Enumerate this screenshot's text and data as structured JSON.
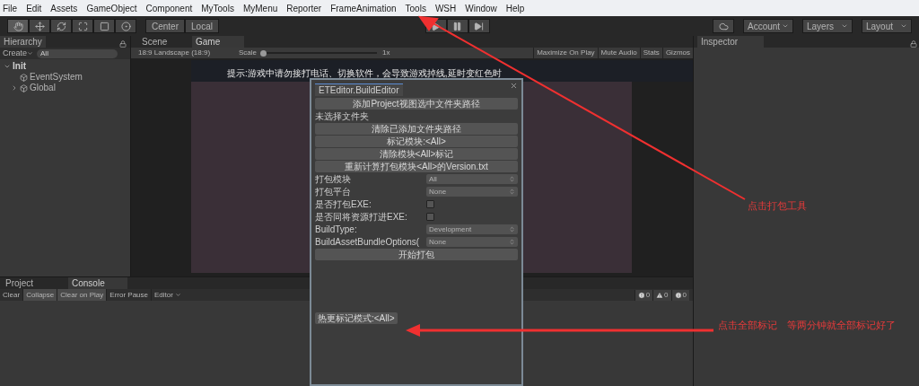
{
  "menu": [
    "File",
    "Edit",
    "Assets",
    "GameObject",
    "Component",
    "MyTools",
    "MyMenu",
    "Reporter",
    "FrameAnimation",
    "Tools",
    "WSH",
    "Window",
    "Help"
  ],
  "toolbar": {
    "tools": [
      {
        "kind": "hand",
        "selected": true
      },
      {
        "kind": "move",
        "selected": false
      },
      {
        "kind": "rotate",
        "selected": false
      },
      {
        "kind": "scale",
        "selected": false
      },
      {
        "kind": "rect",
        "selected": false
      },
      {
        "kind": "transform",
        "selected": false
      }
    ],
    "pivot": [
      "Center",
      "Local"
    ],
    "account": "Account",
    "layers": "Layers",
    "layout": "Layout"
  },
  "hierarchy": {
    "tab": "Hierarchy",
    "create": "Create",
    "search_placeholder": "All",
    "scene": "Init",
    "items": [
      {
        "label": "EventSystem",
        "kind": "leaf"
      },
      {
        "label": "Global",
        "kind": "folded"
      }
    ]
  },
  "view_tabs": [
    {
      "label": "Scene",
      "selected": false
    },
    {
      "label": "Game",
      "selected": true
    }
  ],
  "game": {
    "aspect": "18:9 Landscape (18:9)",
    "scale_label": "Scale",
    "scale": {
      "level": 0.0
    },
    "scale_reading": "1x",
    "toggles": [
      {
        "label": "Maximize On Play",
        "on": false
      },
      {
        "label": "Mute Audio",
        "on": false
      },
      {
        "label": "Stats",
        "on": false
      },
      {
        "label": "Gizmos",
        "on": false
      }
    ],
    "hint": "提示:游戏中请勿接打电话、切换软件，会导致游戏掉线,延时变红色时"
  },
  "inspector": {
    "tab": "Inspector"
  },
  "bottom_tabs": [
    {
      "label": "Project",
      "selected": false
    },
    {
      "label": "Console",
      "selected": true
    }
  ],
  "console": {
    "buttons": [
      {
        "label": "Clear",
        "on": false
      },
      {
        "label": "Collapse",
        "on": true
      },
      {
        "label": "Clear on Play",
        "on": true
      },
      {
        "label": "Error Pause",
        "on": false
      }
    ],
    "editor": "Editor",
    "counts": [
      {
        "kind": "error",
        "count": "0"
      },
      {
        "kind": "warning",
        "count": "0"
      },
      {
        "kind": "info",
        "count": "0"
      }
    ]
  },
  "build_editor": {
    "title": "ETEditor.BuildEditor",
    "rows": [
      {
        "kind": "button",
        "label": "添加Project视图选中文件夹路径"
      },
      {
        "kind": "label",
        "label": "未选择文件夹"
      },
      {
        "kind": "button",
        "label": "清除已添加文件夹路径"
      },
      {
        "kind": "button",
        "label": "标记模块:<All>"
      },
      {
        "kind": "button",
        "label": "清除模块<All>标记"
      },
      {
        "kind": "button",
        "label": "重新计算打包模块<All>的Version.txt"
      },
      {
        "kind": "dropdown",
        "label": "打包模块",
        "value": "All"
      },
      {
        "kind": "dropdown",
        "label": "打包平台",
        "value": "None"
      },
      {
        "kind": "checkbox",
        "label": "是否打包EXE:",
        "checked": false
      },
      {
        "kind": "checkbox",
        "label": "是否同将资源打进EXE:",
        "checked": false
      },
      {
        "kind": "dropdown",
        "label": "BuildType:",
        "value": "Development"
      },
      {
        "kind": "dropdown",
        "label": "BuildAssetBundleOptions(",
        "value": "None"
      },
      {
        "kind": "button",
        "label": "开始打包"
      }
    ],
    "mark_mode_button": "热更标记模式:<All>"
  },
  "annotations": [
    "点击打包工具",
    "点击全部标记　等两分钟就全部标记好了"
  ]
}
